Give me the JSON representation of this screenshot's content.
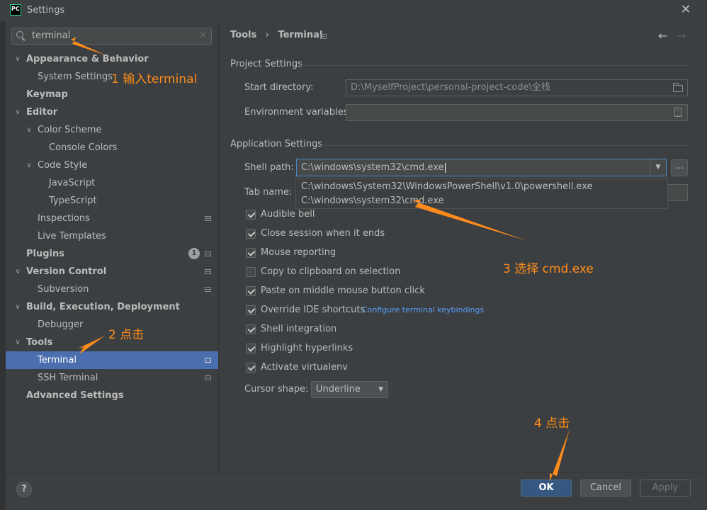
{
  "window": {
    "title": "Settings",
    "logo": "PC",
    "close": "✕"
  },
  "search": {
    "value": "terminal",
    "clear": "×"
  },
  "tree": {
    "appearance": "Appearance & Behavior",
    "system_settings": "System Settings",
    "keymap": "Keymap",
    "editor": "Editor",
    "color_scheme": "Color Scheme",
    "console_colors": "Console Colors",
    "code_style": "Code Style",
    "javascript": "JavaScript",
    "typescript": "TypeScript",
    "inspections": "Inspections",
    "live_templates": "Live Templates",
    "plugins": "Plugins",
    "plugins_badge": "1",
    "version_control": "Version Control",
    "subversion": "Subversion",
    "build": "Build, Execution, Deployment",
    "debugger": "Debugger",
    "tools": "Tools",
    "terminal": "Terminal",
    "ssh_terminal": "SSH Terminal",
    "advanced": "Advanced Settings"
  },
  "breadcrumb": {
    "parent": "Tools",
    "sep": "›",
    "current": "Terminal"
  },
  "nav": {
    "back": "←",
    "forward": "→"
  },
  "project_settings": {
    "title": "Project Settings",
    "start_dir_label": "Start directory:",
    "start_dir_value": "D:\\MyselfProject\\personal-project-code\\全栈",
    "env_label": "Environment variables:",
    "env_value": ""
  },
  "app_settings": {
    "title": "Application Settings",
    "shell_label": "Shell path:",
    "shell_value": "C:\\windows\\system32\\cmd.exe",
    "shell_options": [
      "C:\\windows\\System32\\WindowsPowerShell\\v1.0\\powershell.exe",
      "C:\\windows\\system32\\cmd.exe"
    ],
    "browse": "...",
    "tab_label": "Tab name:",
    "checkboxes": [
      {
        "label": "Audible bell",
        "checked": true
      },
      {
        "label": "Close session when it ends",
        "checked": true
      },
      {
        "label": "Mouse reporting",
        "checked": true
      },
      {
        "label": "Copy to clipboard on selection",
        "checked": false
      },
      {
        "label": "Paste on middle mouse button click",
        "checked": true
      },
      {
        "label": "Override IDE shortcuts",
        "checked": true
      },
      {
        "label": "Shell integration",
        "checked": true
      },
      {
        "label": "Highlight hyperlinks",
        "checked": true
      },
      {
        "label": "Activate virtualenv",
        "checked": true
      }
    ],
    "keybindings_link": "Configure terminal keybindings",
    "cursor_label": "Cursor shape:",
    "cursor_value": "Underline"
  },
  "footer": {
    "help": "?",
    "ok": "OK",
    "cancel": "Cancel",
    "apply": "Apply"
  },
  "annotations": {
    "a1": "1 输入terminal",
    "a2": "2 点击",
    "a3": "3 选择 cmd.exe",
    "a4": "4 点击"
  },
  "colors": {
    "accent": "#4b6eaf",
    "annotation": "#ff8c1a",
    "link": "#589df6"
  }
}
